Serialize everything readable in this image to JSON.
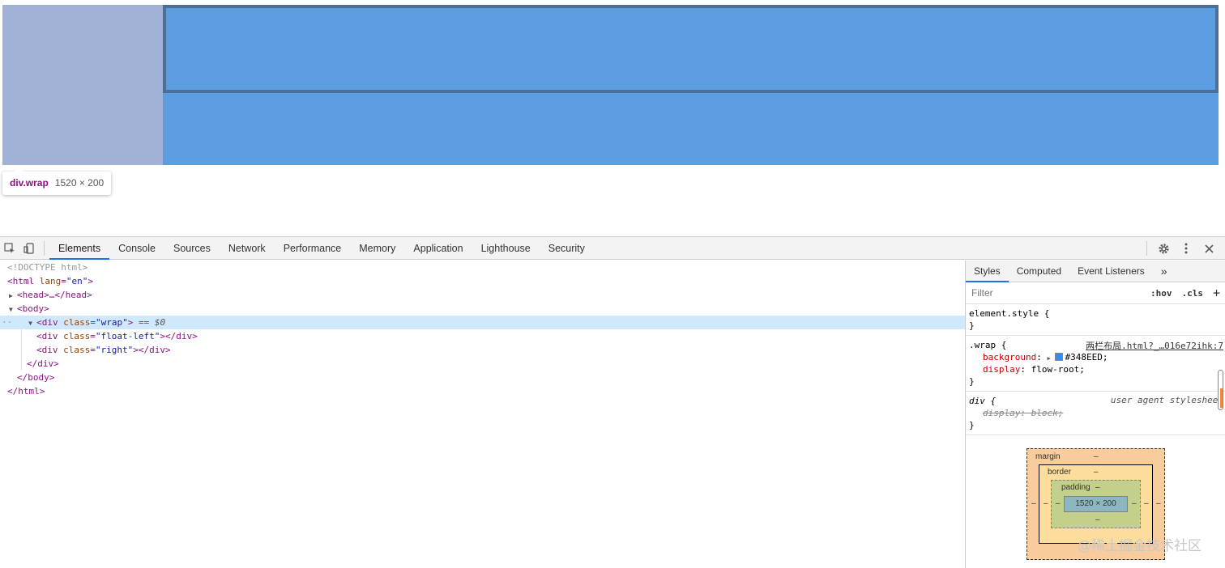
{
  "page": {
    "wrap_color": "#5b9de0",
    "float_left_color": "#a1b2d6",
    "right_border_color": "#4a6f99"
  },
  "tooltip": {
    "tag": "div.wrap",
    "dims": "1520 × 200"
  },
  "devtools": {
    "tabs": [
      "Elements",
      "Console",
      "Sources",
      "Network",
      "Performance",
      "Memory",
      "Application",
      "Lighthouse",
      "Security"
    ],
    "active_tab": "Elements",
    "dom": {
      "doctype": "<!DOCTYPE html>",
      "html_open_tag": "<html",
      "html_attr": "lang",
      "html_val": "\"en\"",
      "head": "<head>…</head>",
      "body_open": "<body>",
      "div_open": "<div",
      "div_attr_class": "class",
      "div_val_wrap": "\"wrap\"",
      "selected_suffix": "== $0",
      "child1_val": "\"float-left\"",
      "child2_val": "\"right\"",
      "div_close": "</div>",
      "body_close": "</body>",
      "html_close": "</html>",
      "ellipsis": "··"
    },
    "sidebar": {
      "tabs": [
        "Styles",
        "Computed",
        "Event Listeners"
      ],
      "more": "»",
      "filter_placeholder": "Filter",
      "hov": ":hov",
      "cls": ".cls",
      "add": "+",
      "element_style": "element.style {",
      "close_brace": "}",
      "wrap_selector": ".wrap {",
      "wrap_source": "两栏布局.html?_…016e72ihk:7",
      "prop_background": "background",
      "val_background": "#348EED",
      "prop_display": "display",
      "val_display": "flow-root",
      "div_selector": "div {",
      "ua_label": "user agent stylesheet",
      "ua_prop": "display: block;"
    },
    "box_model": {
      "margin_label": "margin",
      "border_label": "border",
      "padding_label": "padding",
      "dash": "–",
      "content_dims": "1520 × 200"
    }
  },
  "watermark": "@稀土掘金技术社区"
}
